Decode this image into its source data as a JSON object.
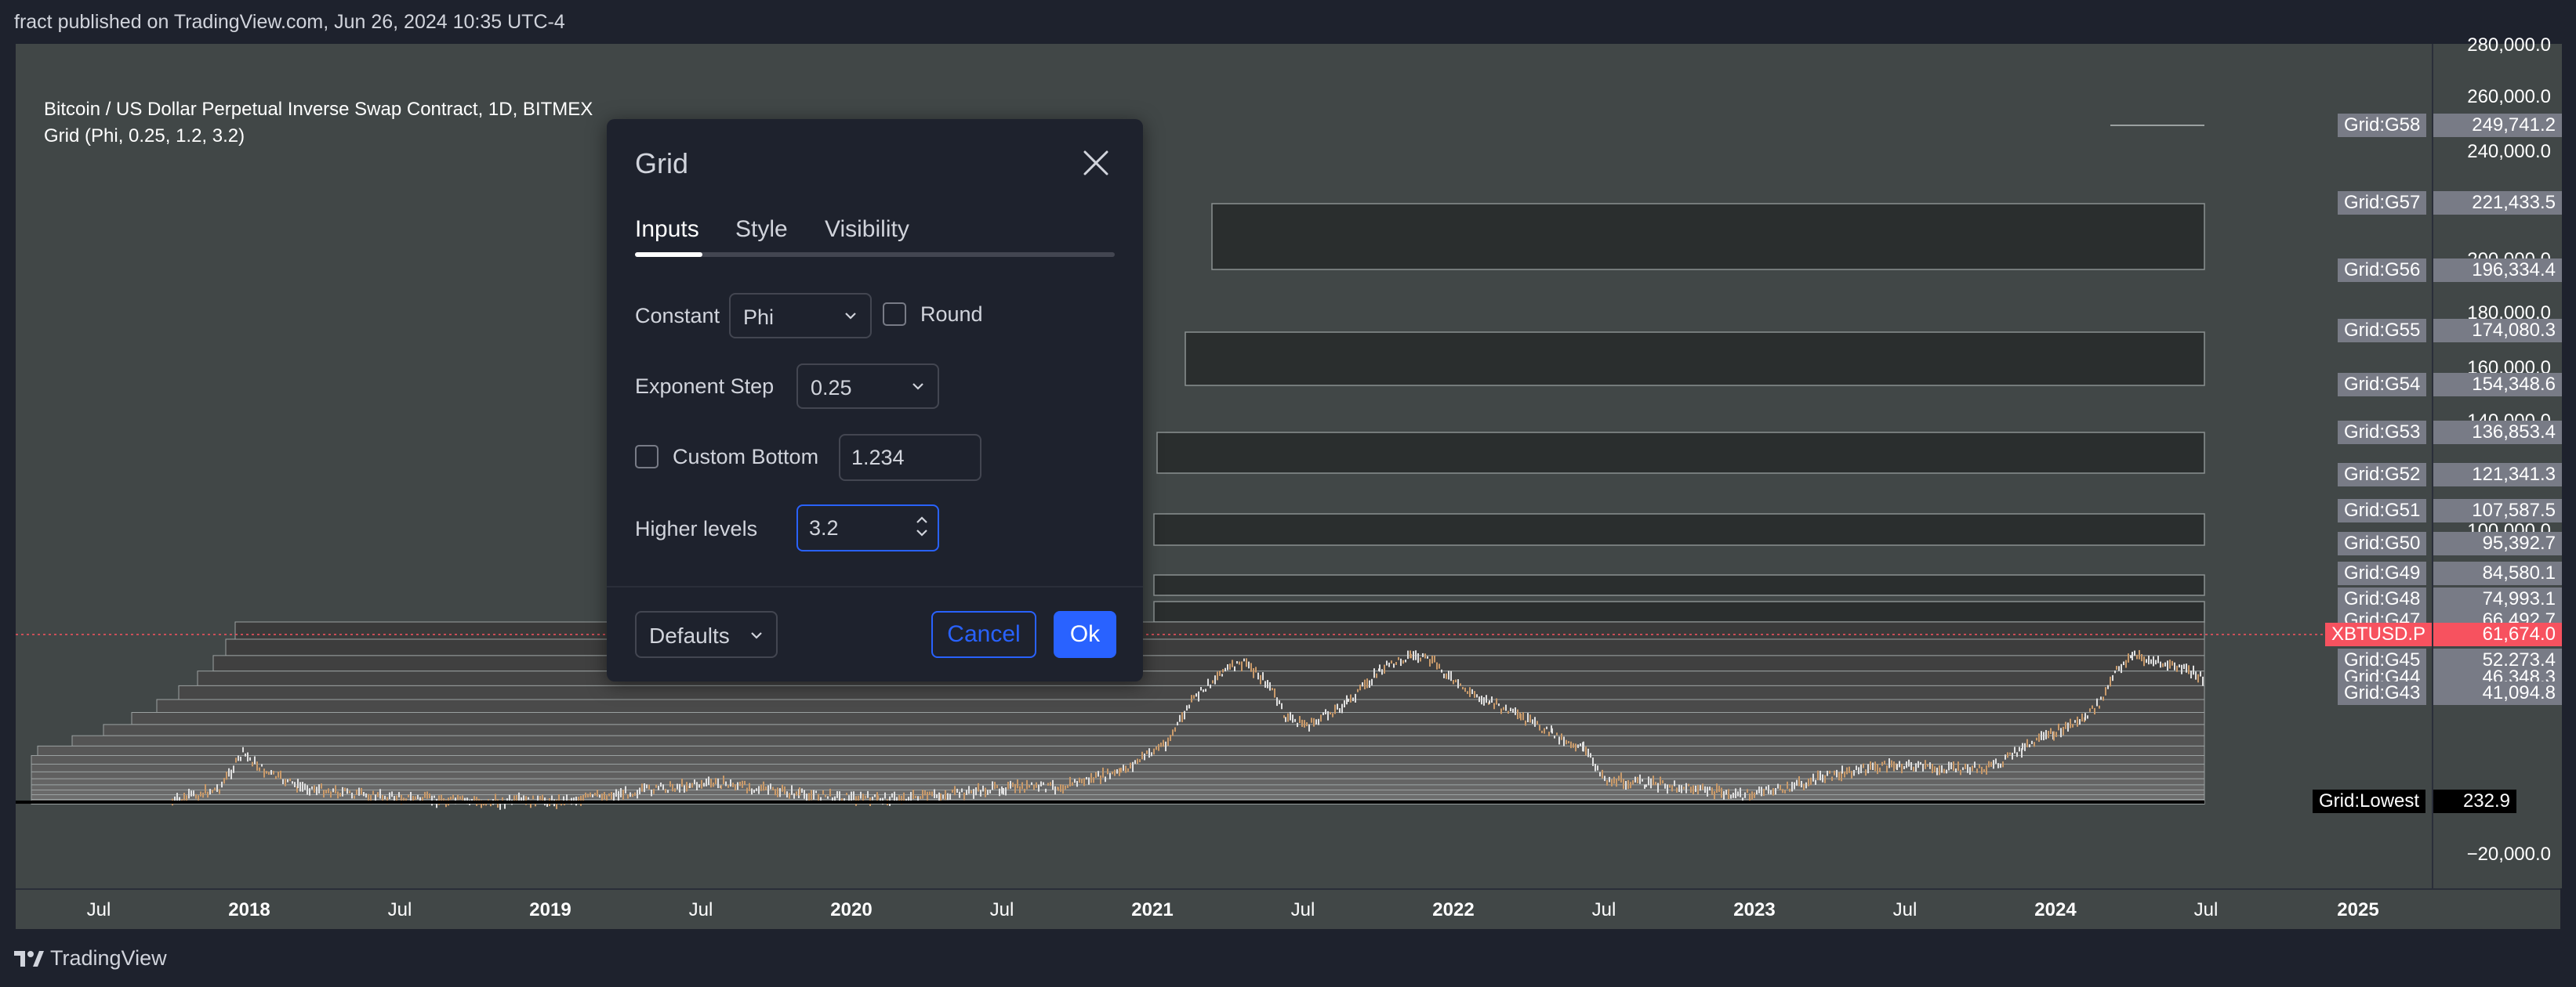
{
  "header": {
    "published": "fract published on TradingView.com, Jun 26, 2024 10:35 UTC-4"
  },
  "chart": {
    "symbol": "Bitcoin / US Dollar Perpetual Inverse Swap Contract, 1D, BITMEX",
    "indicator": "Grid (Phi, 0.25, 1.2, 3.2)",
    "price_axis": [
      "280,000.0",
      "260,000.0",
      "240,000.0",
      "200,000.0",
      "180,000.0",
      "160,000.0",
      "140,000.0",
      "100,000.0",
      "−20,000.0"
    ],
    "time_axis": [
      {
        "label": "Jul",
        "bold": false
      },
      {
        "label": "2018",
        "bold": true
      },
      {
        "label": "Jul",
        "bold": false
      },
      {
        "label": "2019",
        "bold": true
      },
      {
        "label": "Jul",
        "bold": false
      },
      {
        "label": "2020",
        "bold": true
      },
      {
        "label": "Jul",
        "bold": false
      },
      {
        "label": "2021",
        "bold": true
      },
      {
        "label": "Jul",
        "bold": false
      },
      {
        "label": "2022",
        "bold": true
      },
      {
        "label": "Jul",
        "bold": false
      },
      {
        "label": "2023",
        "bold": true
      },
      {
        "label": "Jul",
        "bold": false
      },
      {
        "label": "2024",
        "bold": true
      },
      {
        "label": "Jul",
        "bold": false
      },
      {
        "label": "2025",
        "bold": true
      }
    ],
    "grid_levels": [
      {
        "name": "Grid:G58",
        "value": "249,741.2"
      },
      {
        "name": "Grid:G57",
        "value": "221,433.5"
      },
      {
        "name": "Grid:G56",
        "value": "196,334.4"
      },
      {
        "name": "Grid:G55",
        "value": "174,080.3"
      },
      {
        "name": "Grid:G54",
        "value": "154,348.6"
      },
      {
        "name": "Grid:G53",
        "value": "136,853.4"
      },
      {
        "name": "Grid:G52",
        "value": "121,341.3"
      },
      {
        "name": "Grid:G51",
        "value": "107,587.5"
      },
      {
        "name": "Grid:G50",
        "value": "95,392.7"
      },
      {
        "name": "Grid:G49",
        "value": "84,580.1"
      },
      {
        "name": "Grid:G48",
        "value": "74,993.1"
      },
      {
        "name": "Grid:G47",
        "value": "66,492.7"
      },
      {
        "name": "Grid:G45",
        "value": "52,273.4"
      },
      {
        "name": "Grid:G44",
        "value": "46,348.3"
      },
      {
        "name": "Grid:G43",
        "value": "41,094.8"
      }
    ],
    "current": {
      "symbol": "XBTUSD.P",
      "value": "61,674.0",
      "color": "#f7525f"
    },
    "lowest": {
      "name": "Grid:Lowest",
      "value": "232.9"
    }
  },
  "dialog": {
    "title": "Grid",
    "tabs": [
      {
        "label": "Inputs",
        "active": true
      },
      {
        "label": "Style",
        "active": false
      },
      {
        "label": "Visibility",
        "active": false
      }
    ],
    "constant_label": "Constant",
    "constant_value": "Phi",
    "round_label": "Round",
    "exponent_label": "Exponent Step",
    "exponent_value": "0.25",
    "custom_bottom_label": "Custom Bottom",
    "custom_bottom_value": "1.234",
    "higher_label": "Higher levels",
    "higher_value": "3.2",
    "defaults_label": "Defaults",
    "cancel_label": "Cancel",
    "ok_label": "Ok"
  },
  "footer": {
    "brand": "TradingView"
  },
  "colors": {
    "accent": "#2962ff",
    "bg": "#1e222d",
    "chart_bg": "#414747",
    "current_price": "#f7525f"
  }
}
